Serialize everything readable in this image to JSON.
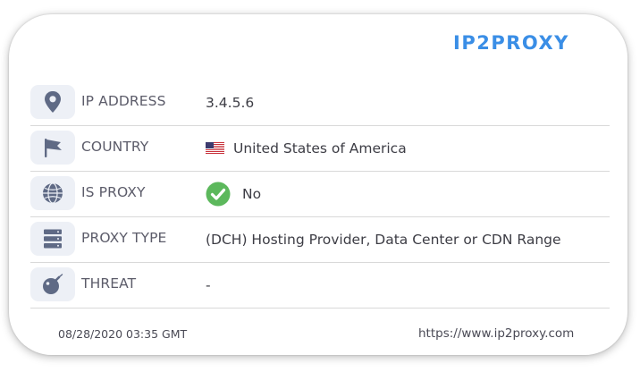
{
  "brand": {
    "logo_text": "IP2PROXY",
    "logo_color": "#3a8ee6"
  },
  "rows": [
    {
      "icon": "map-pin-icon",
      "label": "IP ADDRESS",
      "value": "3.4.5.6"
    },
    {
      "icon": "flag-icon",
      "label": "COUNTRY",
      "value": "United States of America",
      "flag": "us-flag-icon"
    },
    {
      "icon": "globe-icon",
      "label": "IS PROXY",
      "value": "No",
      "status_icon": "green-check-icon",
      "status_color": "#5cb85c"
    },
    {
      "icon": "server-icon",
      "label": "PROXY TYPE",
      "value": "(DCH) Hosting Provider, Data Center or CDN Range"
    },
    {
      "icon": "bomb-icon",
      "label": "THREAT",
      "value": "-"
    }
  ],
  "footer": {
    "timestamp": "08/28/2020 03:35 GMT",
    "url": "https://www.ip2proxy.com"
  }
}
